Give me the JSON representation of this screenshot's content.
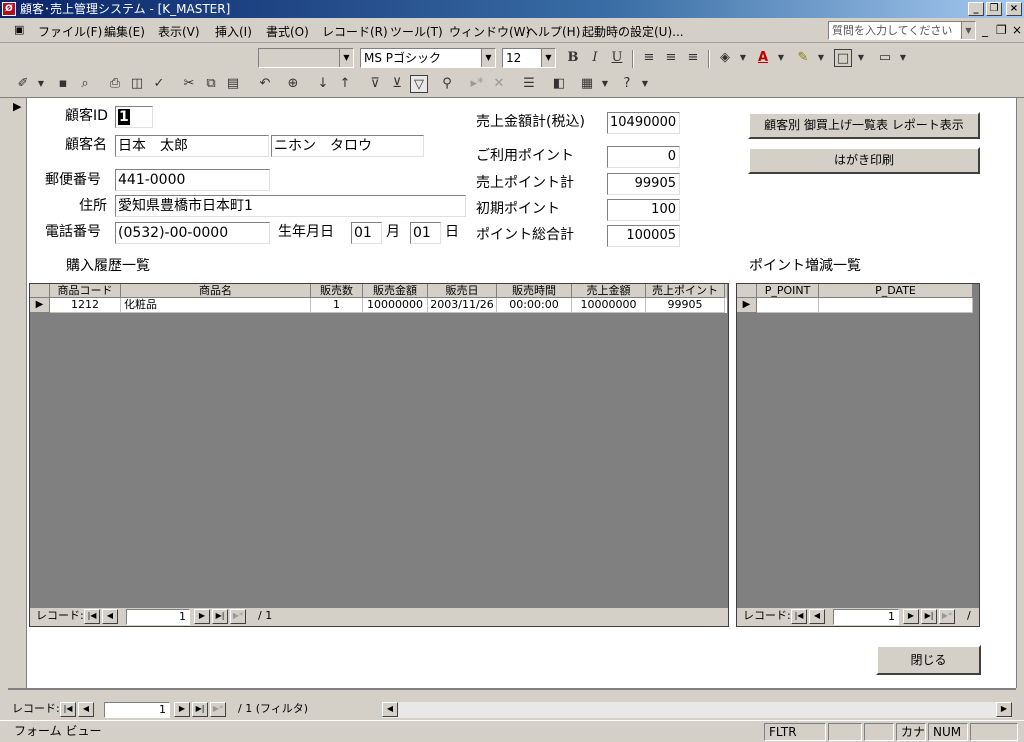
{
  "window": {
    "title": "顧客･売上管理システム - [K_MASTER]",
    "app_icon": "access-icon"
  },
  "menu": {
    "items": [
      "ファイル(F)",
      "編集(E)",
      "表示(V)",
      "挿入(I)",
      "書式(O)",
      "レコード(R)",
      "ツール(T)",
      "ウィンドウ(W)",
      "ヘルプ(H)",
      "起動時の設定(U)..."
    ],
    "help_placeholder": "質問を入力してください"
  },
  "format_toolbar": {
    "font_name": "MS Pゴシック",
    "font_size": "12",
    "bold": "B",
    "italic": "I",
    "underline": "U"
  },
  "form": {
    "customer_id_label": "顧客ID",
    "customer_id": "1",
    "customer_name_label": "顧客名",
    "customer_name": "日本　太郎",
    "customer_kana": "ニホン　タロウ",
    "postal_label": "郵便番号",
    "postal": "441-0000",
    "address_label": "住所",
    "address": "愛知県豊橋市日本町1",
    "phone_label": "電話番号",
    "phone": "(0532)-00-0000",
    "birth_label": "生年月日",
    "birth_month": "01",
    "month_label": "月",
    "birth_day": "01",
    "day_label": "日",
    "sales_total_label": "売上金額計(税込)",
    "sales_total": "10490000",
    "used_points_label": "ご利用ポイント",
    "used_points": "0",
    "sales_points_label": "売上ポイント計",
    "sales_points": "99905",
    "initial_points_label": "初期ポイント",
    "initial_points": "100",
    "points_total_label": "ポイント総合計",
    "points_total": "100005",
    "report_button": "顧客別 御買上げ一覧表 レポート表示",
    "postcard_button": "はがき印刷",
    "close_button": "閉じる"
  },
  "purchase_history": {
    "title": "購入履歴一覧",
    "columns": [
      "商品コード",
      "商品名",
      "販売数",
      "販売金額",
      "販売日",
      "販売時間",
      "売上金額",
      "売上ポイント"
    ],
    "rows": [
      [
        "1212",
        "化粧品",
        "1",
        "10000000",
        "2003/11/26",
        "00:00:00",
        "10000000",
        "99905"
      ]
    ],
    "nav_label": "レコード:",
    "nav_current": "1",
    "nav_total": "/ 1"
  },
  "point_changes": {
    "title": "ポイント増減一覧",
    "columns": [
      "P_POINT",
      "P_DATE"
    ],
    "nav_label": "レコード:",
    "nav_current": "1",
    "nav_total": "/"
  },
  "main_nav": {
    "label": "レコード:",
    "current": "1",
    "total": "/ 1 (フィルタ)"
  },
  "status": {
    "view": "フォーム ビュー",
    "fltr": "FLTR",
    "kana": "カナ",
    "num": "NUM"
  }
}
